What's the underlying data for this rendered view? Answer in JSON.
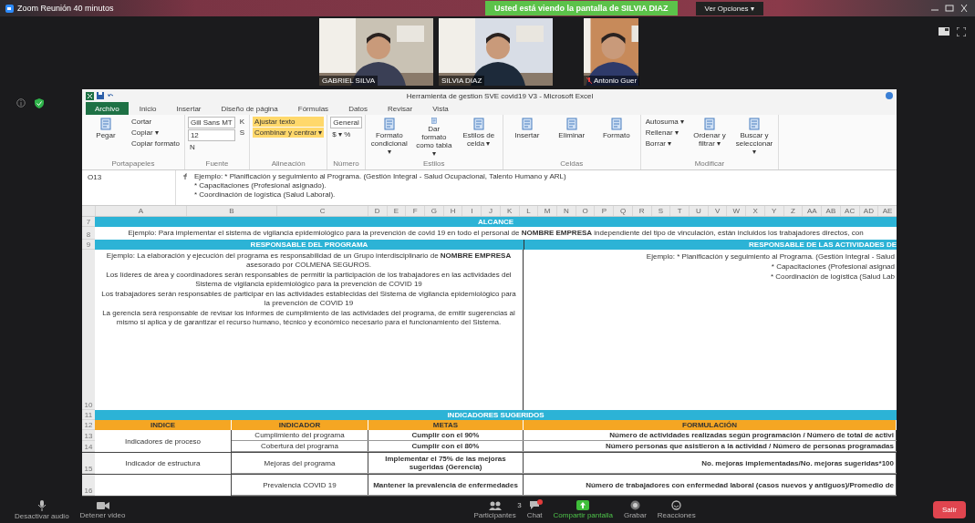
{
  "meeting": {
    "title": "Zoom Reunión 40 minutos",
    "banner": "Usted está viendo la pantalla de SILVIA DIAZ",
    "view_options": "Ver Opciones ▾"
  },
  "participants": [
    {
      "name": "GABRIEL SILVA",
      "muted": false
    },
    {
      "name": "SILVIA DIAZ",
      "muted": false
    },
    {
      "name": "Antonio Guer",
      "muted": true
    }
  ],
  "excel": {
    "title": "Herramienta de gestion SVE covid19 V3 - Microsoft Excel",
    "tabs": [
      {
        "label": "Archivo",
        "selected": true
      },
      {
        "label": "Inicio",
        "selected": false
      },
      {
        "label": "Insertar",
        "selected": false
      },
      {
        "label": "Diseño de página",
        "selected": false
      },
      {
        "label": "Fórmulas",
        "selected": false
      },
      {
        "label": "Datos",
        "selected": false
      },
      {
        "label": "Revisar",
        "selected": false
      },
      {
        "label": "Vista",
        "selected": false
      }
    ],
    "ribbon_groups": [
      {
        "label": "Portapapeles",
        "items": [
          {
            "label": "Pegar",
            "kind": "big",
            "selected": false
          },
          {
            "label": "Cortar",
            "kind": "small",
            "selected": false
          },
          {
            "label": "Copiar ▾",
            "kind": "small",
            "selected": false
          },
          {
            "label": "Copiar formato",
            "kind": "small",
            "selected": false
          }
        ]
      },
      {
        "label": "Fuente",
        "items": [
          {
            "label": "Gill Sans MT",
            "kind": "field",
            "selected": false
          },
          {
            "label": "12",
            "kind": "field",
            "selected": false
          },
          {
            "label": "N",
            "kind": "small",
            "selected": false
          },
          {
            "label": "K",
            "kind": "small",
            "selected": false
          },
          {
            "label": "S",
            "kind": "small",
            "selected": false
          }
        ]
      },
      {
        "label": "Alineación",
        "items": [
          {
            "label": "Ajustar texto",
            "kind": "small",
            "selected": true
          },
          {
            "label": "Combinar y centrar ▾",
            "kind": "small",
            "selected": true
          }
        ]
      },
      {
        "label": "Número",
        "items": [
          {
            "label": "General",
            "kind": "field",
            "selected": false
          },
          {
            "label": "$ ▾ %",
            "kind": "small",
            "selected": false
          }
        ]
      },
      {
        "label": "Estilos",
        "items": [
          {
            "label": "Formato condicional ▾",
            "kind": "big",
            "selected": false
          },
          {
            "label": "Dar formato como tabla ▾",
            "kind": "big",
            "selected": false
          },
          {
            "label": "Estilos de celda ▾",
            "kind": "big",
            "selected": false
          }
        ]
      },
      {
        "label": "Celdas",
        "items": [
          {
            "label": "Insertar",
            "kind": "big",
            "selected": false
          },
          {
            "label": "Eliminar",
            "kind": "big",
            "selected": false
          },
          {
            "label": "Formato",
            "kind": "big",
            "selected": false
          }
        ]
      },
      {
        "label": "Modificar",
        "items": [
          {
            "label": "Autosuma ▾",
            "kind": "small",
            "selected": false
          },
          {
            "label": "Rellenar ▾",
            "kind": "small",
            "selected": false
          },
          {
            "label": "Borrar ▾",
            "kind": "small",
            "selected": false
          },
          {
            "label": "Ordenar y filtrar ▾",
            "kind": "big",
            "selected": false
          },
          {
            "label": "Buscar y seleccionar ▾",
            "kind": "big",
            "selected": false
          }
        ]
      }
    ],
    "name_box": "O13",
    "formula_lines": [
      "Ejemplo: * Planificación y seguimiento al Programa. (Gestión Integral - Salud Ocupacional, Talento Humano y ARL)",
      "* Capacitaciones (Profesional asignado).",
      "* Coordinación de logística (Salud Laboral)."
    ],
    "columns": [
      "A",
      "B",
      "C",
      "D",
      "E",
      "F",
      "G",
      "H",
      "I",
      "J",
      "K",
      "L",
      "M",
      "N",
      "O",
      "P",
      "Q",
      "R",
      "S",
      "T",
      "U",
      "V",
      "W",
      "X",
      "Y",
      "Z",
      "AA",
      "AB",
      "AC",
      "AD",
      "AE"
    ],
    "scope_header": {
      "row": "7",
      "label": "ALCANCE"
    },
    "scope_text": {
      "row": "8",
      "text": "Ejemplo: Para implementar el sistema de vigilancia epidemiológico para la prevención de covid 19 en todo el personal de **NOMBRE EMPRESA** independiente del tipo de vinculación, están incluidos los trabajadores directos, con"
    },
    "responsible_header": {
      "row": "9",
      "left": "RESPONSABLE DEL PROGRAMA",
      "right": "RESPONSABLE DE LAS ACTIVIDADES DE"
    },
    "responsible_text": {
      "row": "10",
      "left": [
        "Ejemplo: La elaboración y ejecución del programa es responsabilidad de un Grupo interdisciplinario de **NOMBRE EMPRESA** asesorado por COLMENA SEGUROS.",
        "Los líderes de área y coordinadores serán responsables de permitir la participación de los trabajadores en las actividades del Sistema de vigilancia epidemiológico para la prevención de COVID 19",
        "Los trabajadores serán responsables de participar en las actividades establecidas del Sistema de vigilancia epidemiológico para la prevención de COVID 19",
        "La gerencia será responsable de revisar los informes de cumplimiento de las actividades del programa, de emitir sugerencias al mismo si aplica y de garantizar el recurso humano, técnico y económico necesario para el funcionamiento del Sistema."
      ],
      "right": [
        "Ejemplo: * Planificación y seguimiento al Programa. (Gestión Integral - Salud",
        "* Capacitaciones (Profesional asignad",
        "* Coordinación de logística (Salud Lab"
      ]
    },
    "indicators_header": {
      "row": "11",
      "label": "INDICADORES SUGERIDOS"
    },
    "indicators_columns": {
      "row": "12",
      "labels": [
        "INDICE",
        "INDICADOR",
        "METAS",
        "FORMULACIÓN"
      ]
    },
    "indicator_groups": [
      {
        "index": "Indicadores de proceso",
        "rows": [
          {
            "row": "13",
            "indicator": "Cumplimiento del programa",
            "goal": "Cumplir con el 90%",
            "formula": "Número de actividades realizadas según programación / Número de total de activi"
          },
          {
            "row": "14",
            "indicator": "Cobertura del programa",
            "goal": "Cumplir con el 80%",
            "formula": "Número personas que asistieron a la actividad / Número de personas programadas"
          }
        ]
      },
      {
        "index": "Indicador de estructura",
        "rows": [
          {
            "row": "15",
            "indicator": "Mejoras del programa",
            "goal": "Implementar el 75% de las mejoras sugeridas (Gerencia)",
            "formula": "No. mejoras implementadas/No. mejoras sugeridas*100"
          }
        ]
      },
      {
        "rows": [
          {
            "row": "16",
            "indicator": "Prevalencia COVID 19",
            "goal": "Mantener la prevalencia de enfermedades",
            "formula": "Número de trabajadores con enfermedad laboral (casos nuevos y antiguos)/Promedio de"
          }
        ]
      }
    ]
  },
  "toolbar": [
    {
      "kind": "mic",
      "label": "Desactivar audio"
    },
    {
      "kind": "video",
      "label": "Detener video"
    },
    {
      "kind": "participants",
      "label": "Participantes",
      "count": "3"
    },
    {
      "kind": "chat",
      "label": "Chat",
      "badge": true
    },
    {
      "kind": "share",
      "label": "Compartir pantalla"
    },
    {
      "kind": "record",
      "label": "Grabar"
    },
    {
      "kind": "reactions",
      "label": "Reacciones"
    }
  ],
  "leave": "Salir"
}
